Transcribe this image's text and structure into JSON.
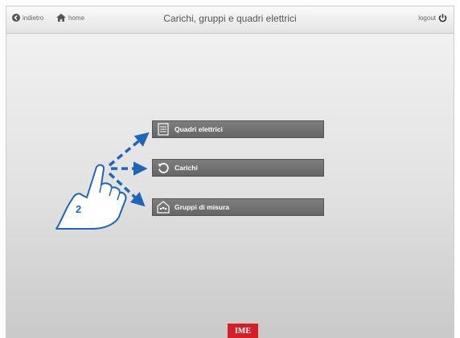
{
  "header": {
    "back_label": "indietro",
    "home_label": "home",
    "title": "Carichi, gruppi e quadri elettrici",
    "logout_label": "logout"
  },
  "menu": {
    "items": [
      {
        "label": "Quadri elettrici",
        "icon": "panel-icon"
      },
      {
        "label": "Carichi",
        "icon": "refresh-icon"
      },
      {
        "label": "Gruppi di misura",
        "icon": "meter-group-icon"
      }
    ]
  },
  "annotation": {
    "step_number": "2"
  },
  "brand": {
    "logo_text": "IME",
    "logo_color": "#d51f26"
  },
  "colors": {
    "arrow": "#1f66b8",
    "button_bg": "#707070"
  }
}
